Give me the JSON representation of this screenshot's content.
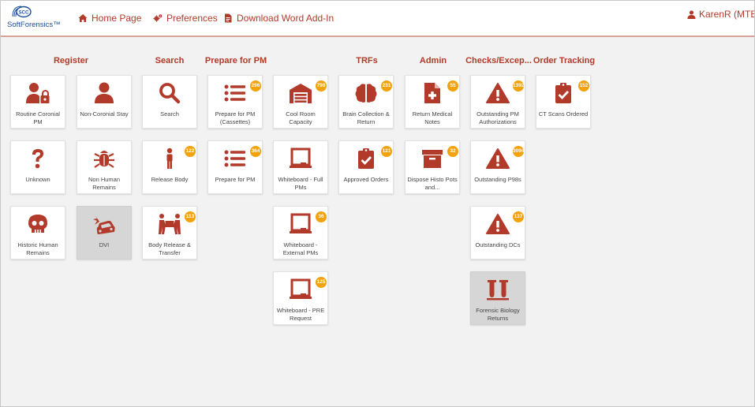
{
  "colors": {
    "accent": "#b23a2a",
    "badge": "#f2a20c",
    "background": "#f2f2f2",
    "logo": "#1b4f9c"
  },
  "header": {
    "logo_badge": "SCC",
    "logo_text": "SoftForensics™",
    "nav": [
      {
        "label": "Home Page",
        "icon": "home-icon"
      },
      {
        "label": "Preferences",
        "icon": "gears-icon"
      },
      {
        "label": "Download Word Add-In",
        "icon": "document-icon"
      }
    ],
    "user": {
      "label": "KarenR (MTECH",
      "icon": "user-icon"
    }
  },
  "columns": [
    "Register",
    "Search",
    "Prepare for PM",
    "",
    "TRFs",
    "Admin",
    "Checks/Excep...",
    "Order Tracking"
  ],
  "tiles": {
    "routine_coronial": {
      "label": "Routine Coronial PM",
      "icon": "user-lock-icon"
    },
    "unknown": {
      "label": "Unknown",
      "icon": "question-icon"
    },
    "historic_human": {
      "label": "Historic Human Remains",
      "icon": "skull-icon"
    },
    "non_coronial": {
      "label": "Non-Coronial Stay",
      "icon": "user-icon"
    },
    "non_human": {
      "label": "Non Human Remains",
      "icon": "bug-icon"
    },
    "dvi": {
      "label": "DVI",
      "icon": "car-crash-icon"
    },
    "search": {
      "label": "Search",
      "icon": "search-icon"
    },
    "release_body": {
      "label": "Release Body",
      "icon": "person-icon",
      "badge": "122"
    },
    "body_release": {
      "label": "Body Release & Transfer",
      "icon": "people-carry-icon",
      "badge": "113"
    },
    "prepare_cassettes": {
      "label": "Prepare for PM (Cassettes)",
      "icon": "list-icon",
      "badge": "296"
    },
    "prepare_pm": {
      "label": "Prepare for PM",
      "icon": "list-icon",
      "badge": "364"
    },
    "cool_room": {
      "label": "Cool Room Capacity",
      "icon": "warehouse-icon",
      "badge": "798"
    },
    "wb_full": {
      "label": "Whiteboard - Full PMs",
      "icon": "chalkboard-icon"
    },
    "wb_external": {
      "label": "Whiteboard - External PMs",
      "icon": "chalkboard-icon",
      "badge": "36"
    },
    "wb_pre": {
      "label": "Whiteboard - PRE Request",
      "icon": "chalkboard-icon",
      "badge": "125"
    },
    "brain": {
      "label": "Brain Collection & Return",
      "icon": "brain-icon",
      "badge": "231"
    },
    "approved_orders": {
      "label": "Approved Orders",
      "icon": "clipboard-check-icon",
      "badge": "121"
    },
    "return_medical": {
      "label": "Return Medical Notes",
      "icon": "file-medical-icon",
      "badge": "55"
    },
    "dispose_histo": {
      "label": "Dispose Histo Pots and...",
      "icon": "archive-icon",
      "badge": "32"
    },
    "outstanding_pm": {
      "label": "Outstanding PM Authorizations",
      "icon": "warning-icon",
      "badge": "1392"
    },
    "outstanding_p98": {
      "label": "Outstanding P98s",
      "icon": "warning-icon",
      "badge": "3094"
    },
    "outstanding_dc": {
      "label": "Outstanding DCs",
      "icon": "warning-icon",
      "badge": "137"
    },
    "forensic_biology": {
      "label": "Forensic Biology Returns",
      "icon": "vials-icon"
    },
    "ct_scans": {
      "label": "CT Scans Ordered",
      "icon": "clipboard-check-icon",
      "badge": "152"
    }
  }
}
